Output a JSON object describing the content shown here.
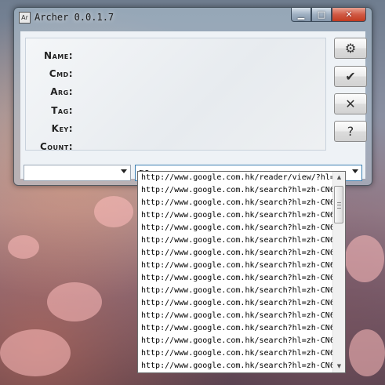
{
  "window": {
    "title": "Archer 0.0.1.7",
    "app_icon": "Ar",
    "controls": {
      "minimize_glyph": "▁",
      "maximize_glyph": "□",
      "close_glyph": "✕"
    }
  },
  "fields": [
    {
      "label": "Name:"
    },
    {
      "label": "Cmd:"
    },
    {
      "label": "Arg:"
    },
    {
      "label": "Tag:"
    },
    {
      "label": "Key:"
    },
    {
      "label": "Count:"
    }
  ],
  "buttons": {
    "settings_glyph": "⚙",
    "confirm_glyph": "✔",
    "cancel_glyph": "✕",
    "help_glyph": "?"
  },
  "combos": {
    "left_value": "",
    "right_value": "go"
  },
  "dropdown": {
    "items": [
      "http://www.google.com.hk/reader/view/?hl=",
      "http://www.google.com.hk/search?hl=zh-CN6",
      "http://www.google.com.hk/search?hl=zh-CN6",
      "http://www.google.com.hk/search?hl=zh-CN6",
      "http://www.google.com.hk/search?hl=zh-CN6",
      "http://www.google.com.hk/search?hl=zh-CN6",
      "http://www.google.com.hk/search?hl=zh-CN6",
      "http://www.google.com.hk/search?hl=zh-CN6",
      "http://www.google.com.hk/search?hl=zh-CN6",
      "http://www.google.com.hk/search?hl=zh-CN6",
      "http://www.google.com.hk/search?hl=zh-CN6",
      "http://www.google.com.hk/search?hl=zh-CN6",
      "http://www.google.com.hk/search?hl=zh-CN6",
      "http://www.google.com.hk/search?hl=zh-CN6",
      "http://www.google.com.hk/search?hl=zh-CN6",
      "http://www.google.com.hk/search?hl=zh-CN6"
    ]
  },
  "colors": {
    "close_button": "#c23a20",
    "panel_background": "#eef2f6"
  }
}
